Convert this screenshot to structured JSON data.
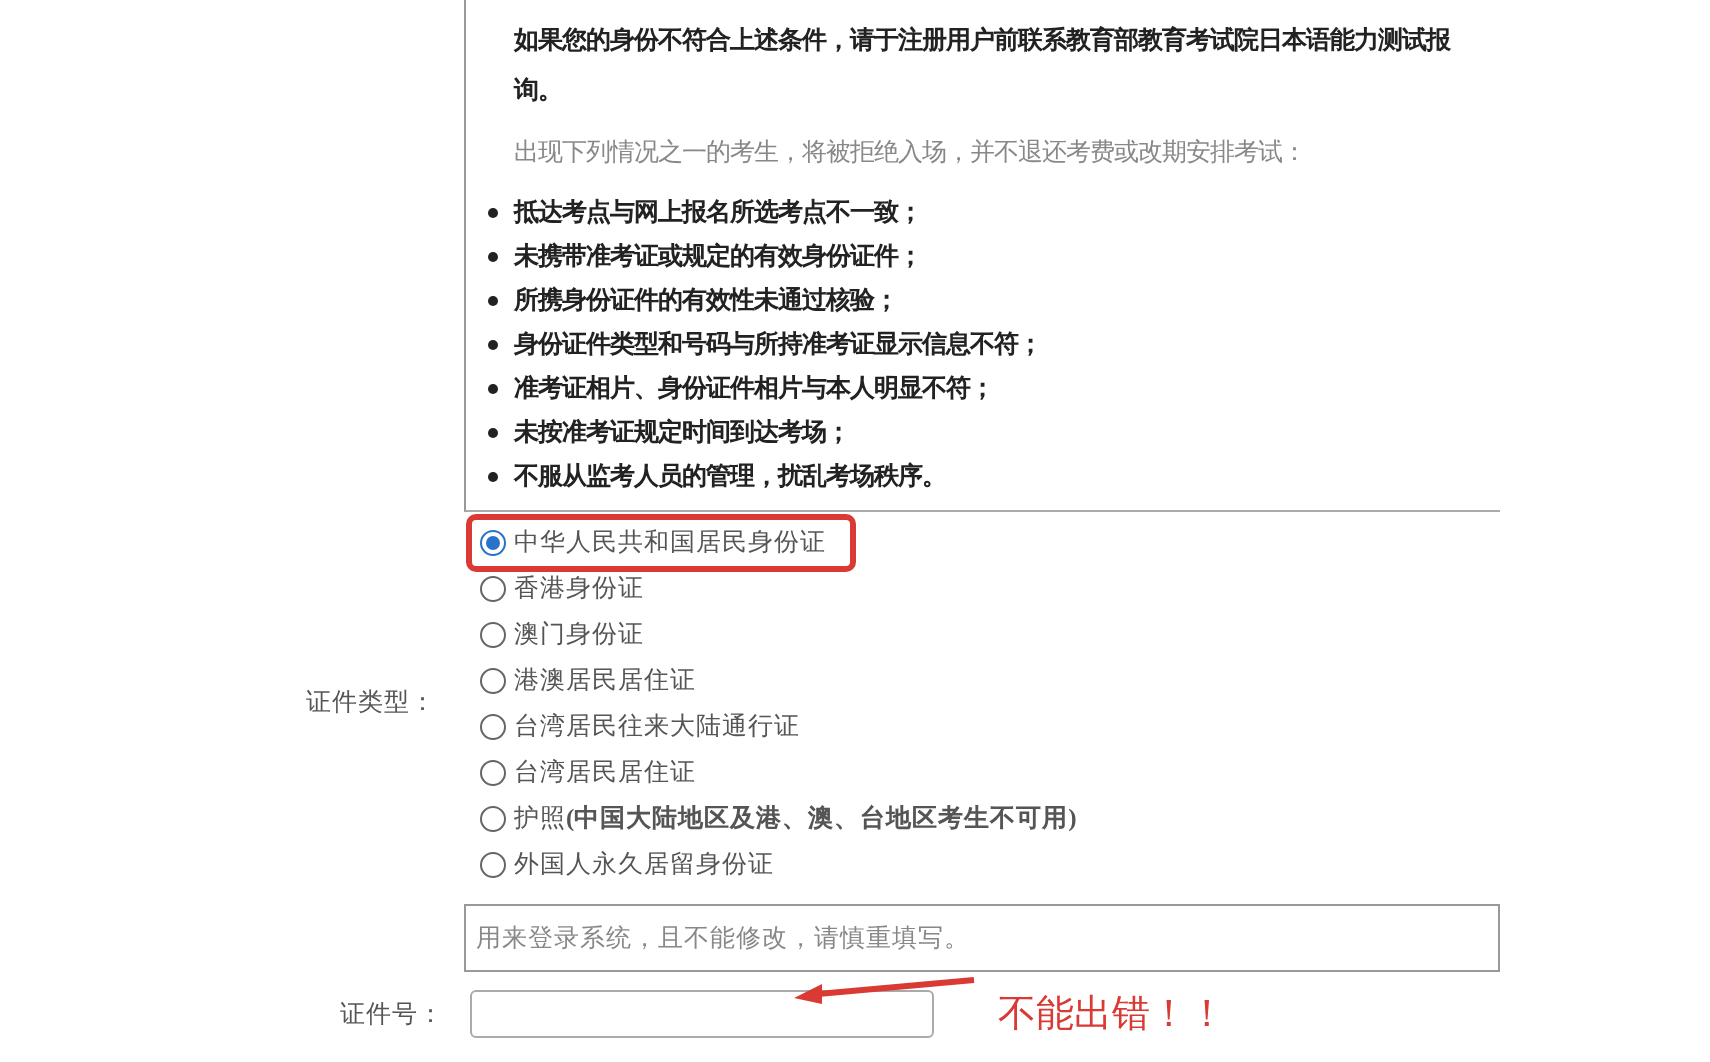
{
  "notice": {
    "intro_lines": [
      "如果您的身份不符合上述条件，请于注册用户前联系教育部教育考试院日本语能力测试报",
      "询。"
    ],
    "refusal_lead": "出现下列情况之一的考生，将被拒绝入场，并不退还考费或改期安排考试：",
    "refusal_items": [
      "抵达考点与网上报名所选考点不一致；",
      "未携带准考证或规定的有效身份证件；",
      "所携身份证件的有效性未通过核验；",
      "身份证件类型和号码与所持准考证显示信息不符；",
      "准考证相片、身份证件相片与本人明显不符；",
      "未按准考证规定时间到达考场；",
      "不服从监考人员的管理，扰乱考场秩序。"
    ]
  },
  "id_type": {
    "label": "证件类型：",
    "options": [
      {
        "label": "中华人民共和国居民身份证",
        "selected": true,
        "highlighted": true
      },
      {
        "label": "香港身份证",
        "selected": false,
        "highlighted": false
      },
      {
        "label": "澳门身份证",
        "selected": false,
        "highlighted": false
      },
      {
        "label": "港澳居民居住证",
        "selected": false,
        "highlighted": false
      },
      {
        "label": "台湾居民往来大陆通行证",
        "selected": false,
        "highlighted": false
      },
      {
        "label": "台湾居民居住证",
        "selected": false,
        "highlighted": false
      },
      {
        "label": "护照**(中国大陆地区及港、澳、台地区考生不可用)**",
        "selected": false,
        "highlighted": false
      },
      {
        "label": "外国人永久居留身份证",
        "selected": false,
        "highlighted": false
      }
    ]
  },
  "id_number": {
    "hint": "用来登录系统，且不能修改，请慎重填写。",
    "label": "证件号："
  },
  "annotation": {
    "text": "不能出错！！"
  }
}
